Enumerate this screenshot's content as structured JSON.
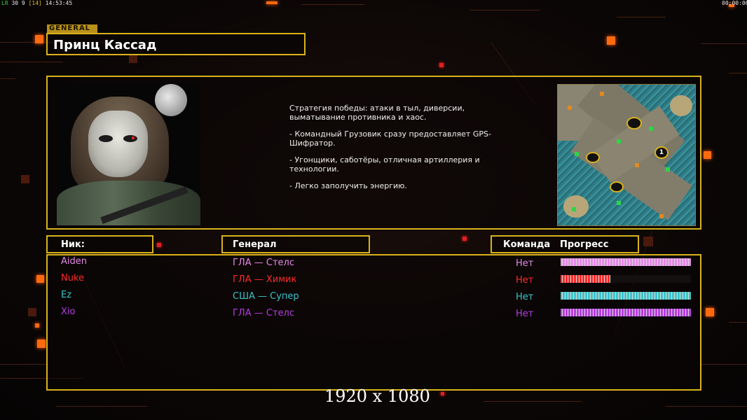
{
  "overlay": {
    "left_tag": "LR",
    "fps": "30 9",
    "fps_bracket": "[14]",
    "clock": "14:53:45",
    "timer": "00:00:00"
  },
  "general": {
    "tag": "GENERAL",
    "name": "Принц Кассад",
    "description": [
      "Стратегия победы: атаки в тыл, диверсии, выматывание противника и хаос.",
      "- Командный Грузовик сразу предоставляет GPS-Шифратор.",
      "- Угонщики, саботёры, отличная артиллерия и технологии.",
      "- Легко заполучить энергию."
    ]
  },
  "players_table": {
    "headers": {
      "nick": "Ник:",
      "general": "Генерал",
      "team": "Команда",
      "progress": "Прогресс"
    },
    "rows": [
      {
        "nick": "Aiden",
        "general": "ГЛА — Стелс",
        "team": "Нет",
        "progress": 1.0,
        "color": "#e58ae8"
      },
      {
        "nick": "Nuke",
        "general": "ГЛА — Химик",
        "team": "Нет",
        "progress": 0.38,
        "color": "#ff2a2a"
      },
      {
        "nick": "Ez",
        "general": "США — Супер",
        "team": "Нет",
        "progress": 1.0,
        "color": "#3cc3c8"
      },
      {
        "nick": "Xio",
        "general": "ГЛА — Стелс",
        "team": "Нет",
        "progress": 1.0,
        "color": "#b43ee0"
      }
    ]
  },
  "caption": "1920 x 1080"
}
